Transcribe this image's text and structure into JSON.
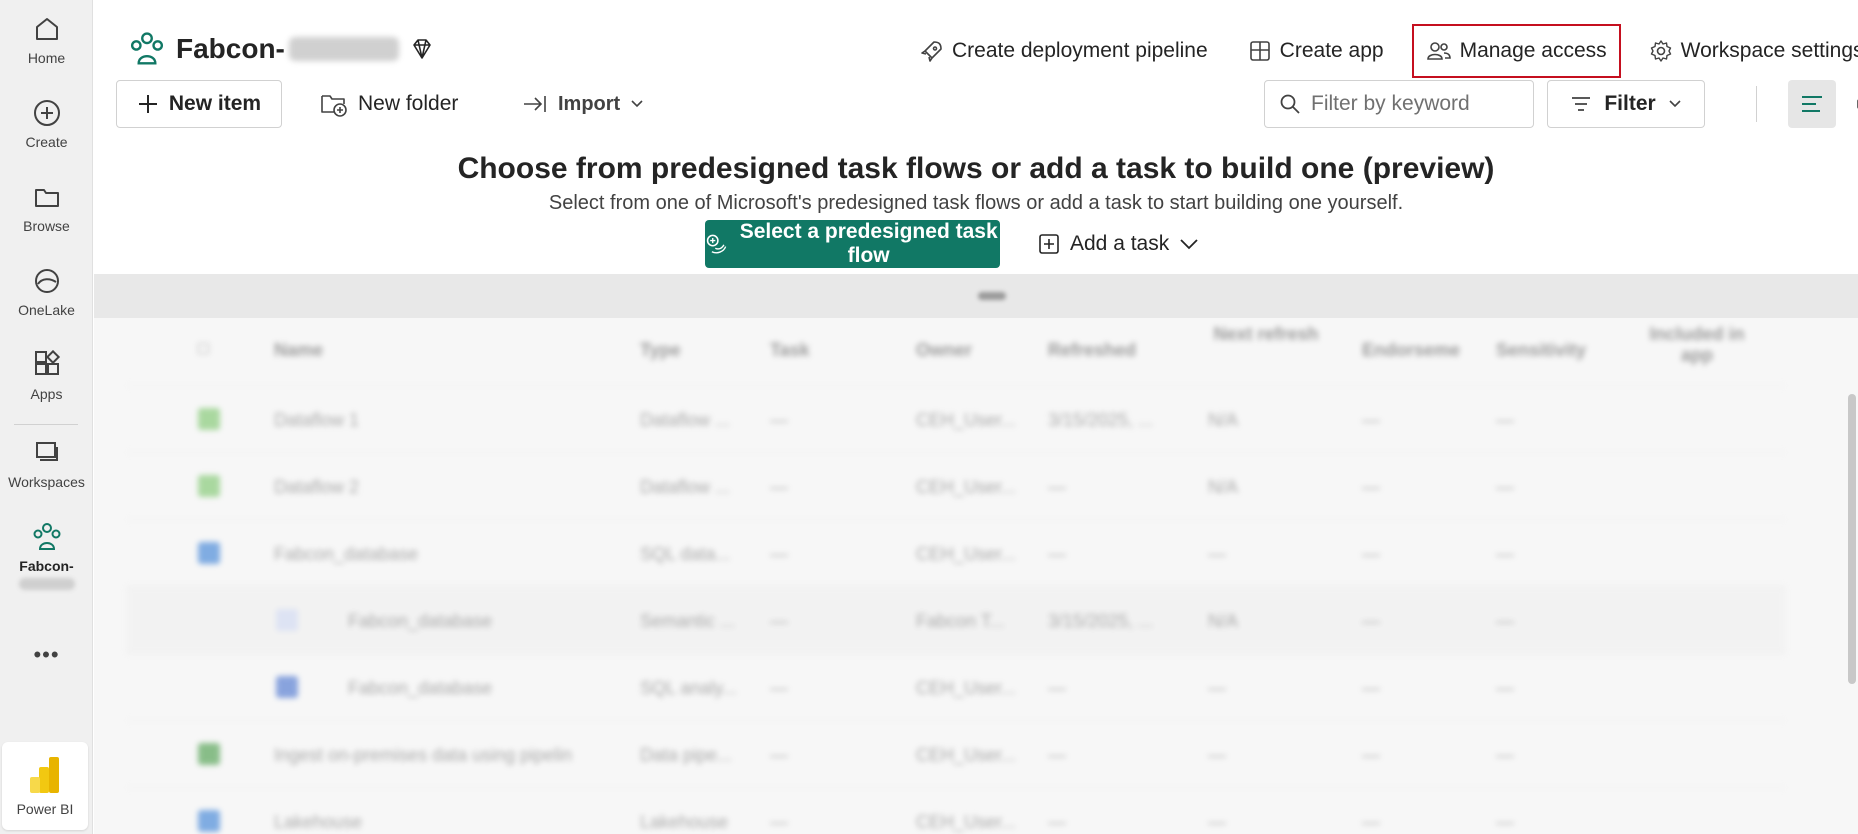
{
  "rail": {
    "items": [
      {
        "label": "Home"
      },
      {
        "label": "Create"
      },
      {
        "label": "Browse"
      },
      {
        "label": "OneLake"
      },
      {
        "label": "Apps"
      },
      {
        "label": "Workspaces"
      },
      {
        "label": "Fabcon-"
      }
    ],
    "more": "•••",
    "footer_label": "Power BI"
  },
  "header": {
    "workspace_name": "Fabcon-",
    "actions": [
      {
        "label": "Create deployment pipeline",
        "icon": "rocket-icon"
      },
      {
        "label": "Create app",
        "icon": "app-icon"
      },
      {
        "label": "Manage access",
        "icon": "people-icon"
      },
      {
        "label": "Workspace settings",
        "icon": "gear-icon"
      }
    ],
    "highlight_color": "#c50f1f"
  },
  "toolbar": {
    "new_item": "New item",
    "new_folder": "New folder",
    "import": "Import",
    "filter_placeholder": "Filter by keyword",
    "filter": "Filter"
  },
  "banner": {
    "title": "Choose from predesigned task flows or add a task to build one (preview)",
    "subtitle": "Select from one of Microsoft's predesigned task flows or add a task to start building one yourself.",
    "primary_button": "Select a predesigned task flow",
    "add_task": "Add a task",
    "accent": "#117865"
  },
  "list": {
    "columns": [
      "Name",
      "Type",
      "Task",
      "Owner",
      "Refreshed",
      "Next refresh",
      "Endorseme",
      "Sensitivity",
      "Included in app"
    ],
    "rows": [
      {
        "name": "Dataflow 1",
        "type": "Dataflow ...",
        "task": "—",
        "owner": "CEH_User...",
        "refreshed": "3/15/2025, ...",
        "next": "N/A",
        "endorse": "—",
        "sens": "—"
      },
      {
        "name": "Dataflow 2",
        "type": "Dataflow ...",
        "task": "—",
        "owner": "CEH_User...",
        "refreshed": "—",
        "next": "N/A",
        "endorse": "—",
        "sens": "—"
      },
      {
        "name": "Fabcon_database",
        "type": "SQL data...",
        "task": "—",
        "owner": "CEH_User...",
        "refreshed": "—",
        "next": "—",
        "endorse": "—",
        "sens": "—"
      },
      {
        "name": "Fabcon_database",
        "type": "Semantic ...",
        "task": "—",
        "owner": "Fabcon T...",
        "refreshed": "3/15/2025, ...",
        "next": "N/A",
        "endorse": "—",
        "sens": "—"
      },
      {
        "name": "Fabcon_database",
        "type": "SQL analy...",
        "task": "—",
        "owner": "CEH_User...",
        "refreshed": "—",
        "next": "—",
        "endorse": "—",
        "sens": "—"
      },
      {
        "name": "Ingest on-premises data using pipelin",
        "type": "Data pipe...",
        "task": "—",
        "owner": "CEH_User...",
        "refreshed": "—",
        "next": "—",
        "endorse": "—",
        "sens": "—"
      },
      {
        "name": "Lakehouse",
        "type": "Lakehouse",
        "task": "—",
        "owner": "CEH_User...",
        "refreshed": "—",
        "next": "—",
        "endorse": "—",
        "sens": "—"
      }
    ]
  }
}
